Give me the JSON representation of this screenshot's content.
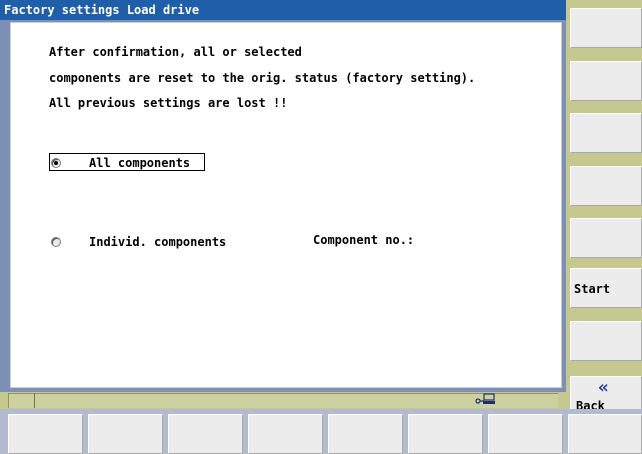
{
  "dialog": {
    "title": "Factory settings Load drive",
    "message_lines": [
      "After confirmation, all or selected",
      "components are reset to the orig. status (factory setting).",
      "All previous settings are lost !!"
    ],
    "options": {
      "all": {
        "label": "All components",
        "selected": true
      },
      "individual": {
        "label": "Individ. components",
        "selected": false
      }
    },
    "component_no_label": "Component no.:"
  },
  "softkeys_right": {
    "start": "Start",
    "back": "Back",
    "back_icon": "double-chevron-left-icon"
  },
  "statusbar": {
    "icon": "network-drive-icon"
  },
  "colors": {
    "title_bar": "#1f5faa",
    "softkey_area": "#c5c98f",
    "frame": "#7d8fb4"
  }
}
